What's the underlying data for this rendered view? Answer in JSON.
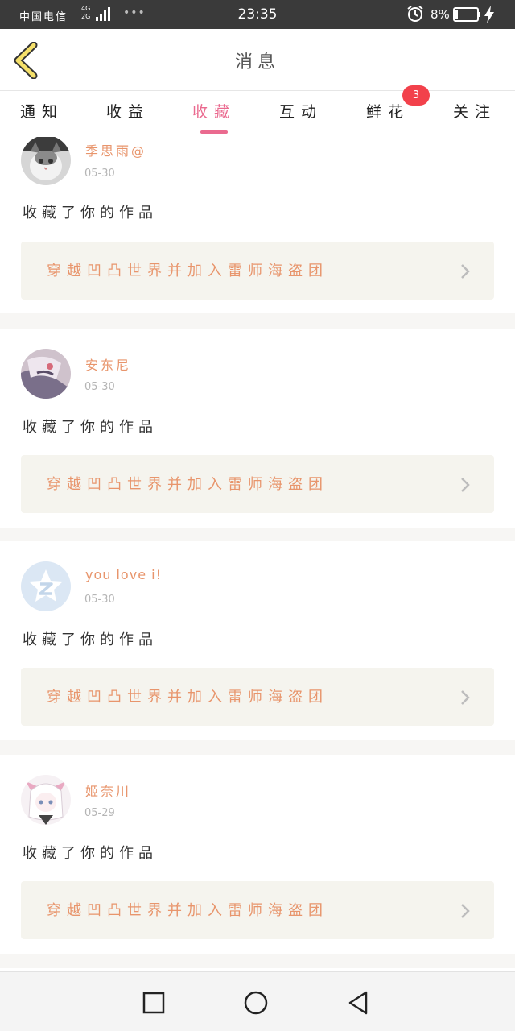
{
  "status_bar": {
    "carrier": "中国电信",
    "network_top": "4G",
    "network_bottom": "2G",
    "dots": "•••",
    "time": "23:35",
    "battery": "8%"
  },
  "header": {
    "title": "消息",
    "back_icon": "chevron-left-icon"
  },
  "tabs": [
    {
      "label": "通知",
      "active": false
    },
    {
      "label": "收益",
      "active": false
    },
    {
      "label": "收藏",
      "active": true
    },
    {
      "label": "互动",
      "active": false
    },
    {
      "label": "鲜花",
      "active": false
    },
    {
      "label": "关注",
      "active": false
    }
  ],
  "badge": {
    "count": "3"
  },
  "items": [
    {
      "name": "季思雨@",
      "date": "05-30",
      "action": "收藏了你的作品",
      "work": "穿越凹凸世界并加入雷师海盗团"
    },
    {
      "name": "安东尼",
      "date": "05-30",
      "action": "收藏了你的作品",
      "work": "穿越凹凸世界并加入雷师海盗团"
    },
    {
      "name": "you love i!",
      "date": "05-30",
      "action": "收藏了你的作品",
      "work": "穿越凹凸世界并加入雷师海盗团"
    },
    {
      "name": "姬奈川",
      "date": "05-29",
      "action": "收藏了你的作品",
      "work": "穿越凹凸世界并加入雷师海盗团"
    }
  ],
  "colors": {
    "accent_pink": "#ea6a8f",
    "name_orange": "#e8956c",
    "badge_red": "#f2414b",
    "work_bg": "#f5f4ee",
    "back_yellow": "#f5e06a"
  },
  "nav": [
    "square-icon",
    "circle-icon",
    "triangle-back-icon"
  ]
}
